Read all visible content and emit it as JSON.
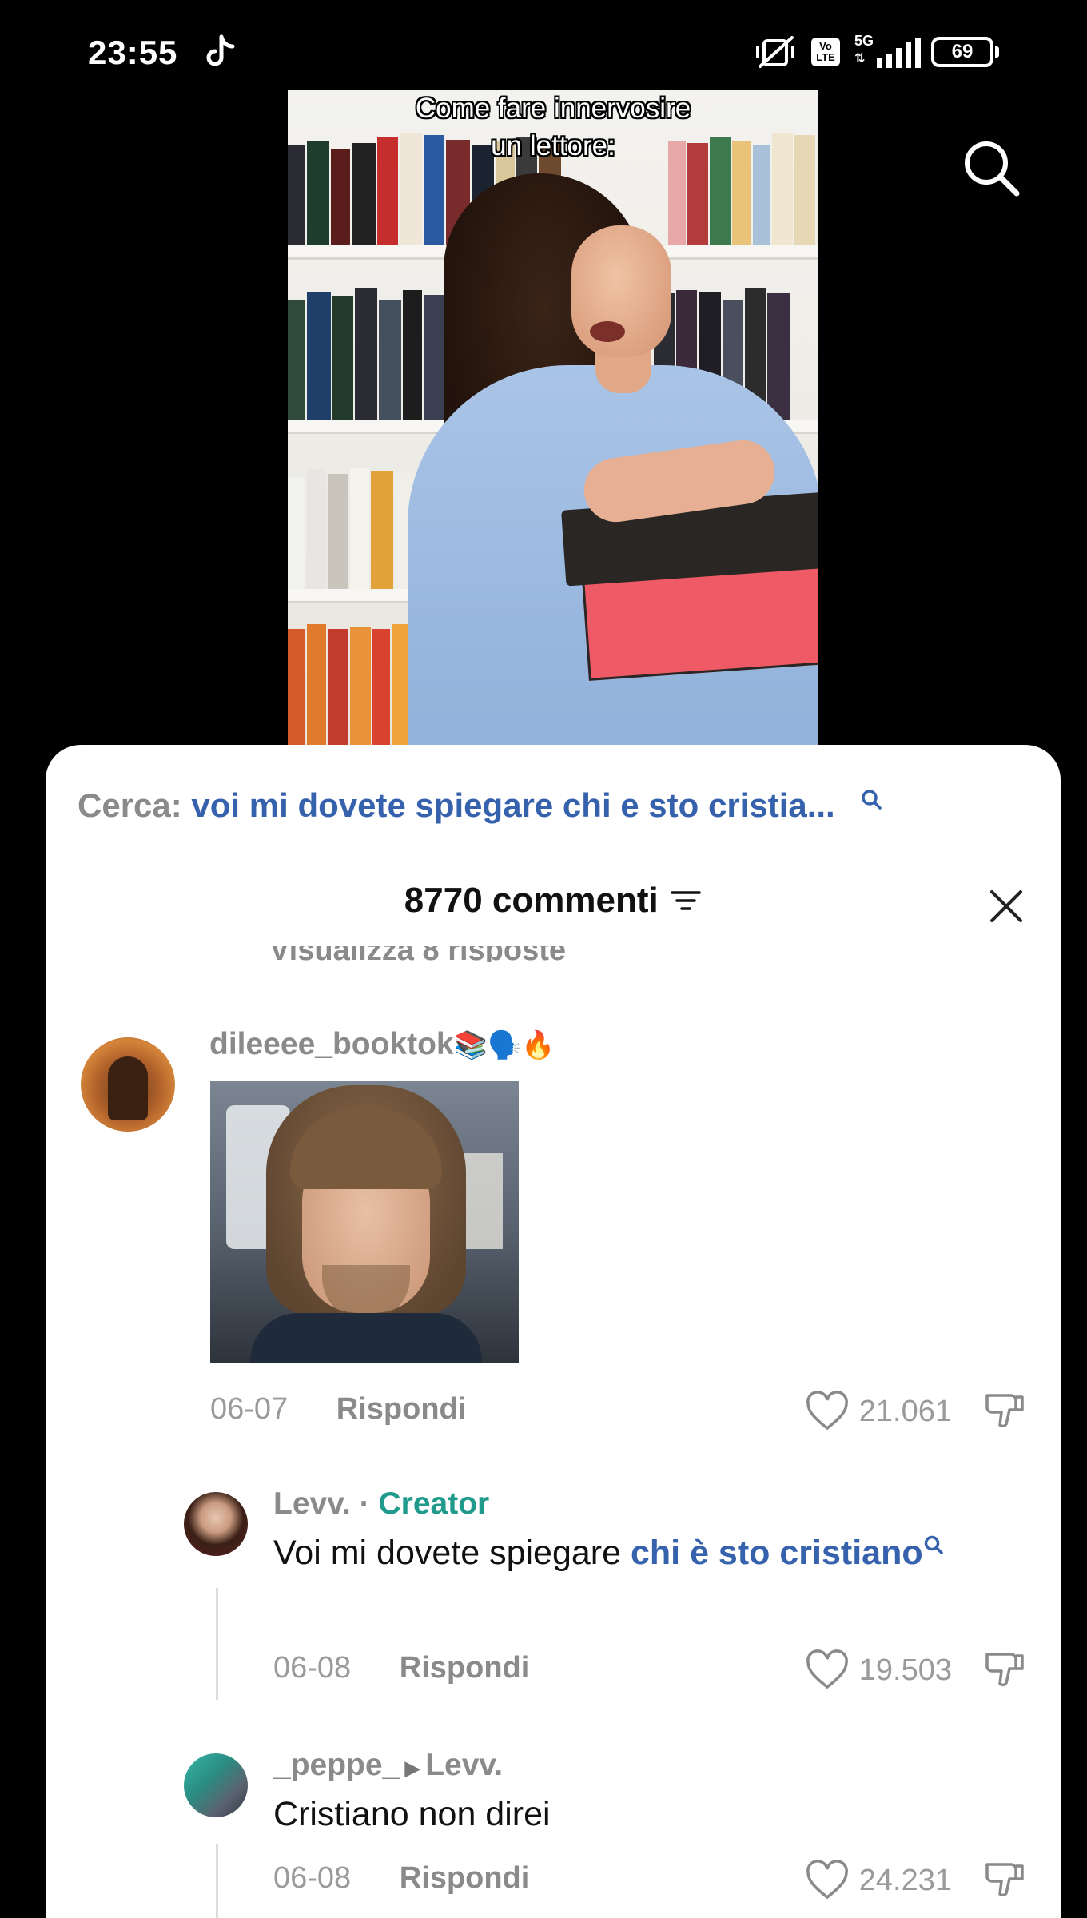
{
  "status_bar": {
    "time": "23:55",
    "volte": "Vo LTE",
    "network": "5G",
    "battery": "69"
  },
  "video": {
    "caption_line1": "Come fare innervosire",
    "caption_line2": "un lettore:"
  },
  "comments_sheet": {
    "suggest_label": "Cerca:",
    "suggest_query": "voi mi dovete spiegare chi e sto cristia...",
    "title": "8770 commenti",
    "cut_off_text": "Visualizza 8 risposte"
  },
  "comments": [
    {
      "username": "dileeee_booktok",
      "username_emoji": "📚🗣️🔥",
      "date": "06-07",
      "reply_label": "Rispondi",
      "likes": "21.061"
    },
    {
      "username": "Levv.",
      "creator_badge": "Creator",
      "text_plain": "Voi mi dovete spiegare ",
      "text_link": "chi è sto cristiano",
      "date": "06-08",
      "reply_label": "Rispondi",
      "likes": "19.503"
    },
    {
      "username": "_peppe_",
      "reply_to": "Levv.",
      "text": "Cristiano non direi",
      "date": "06-08",
      "reply_label": "Rispondi",
      "likes": "24.231"
    }
  ]
}
